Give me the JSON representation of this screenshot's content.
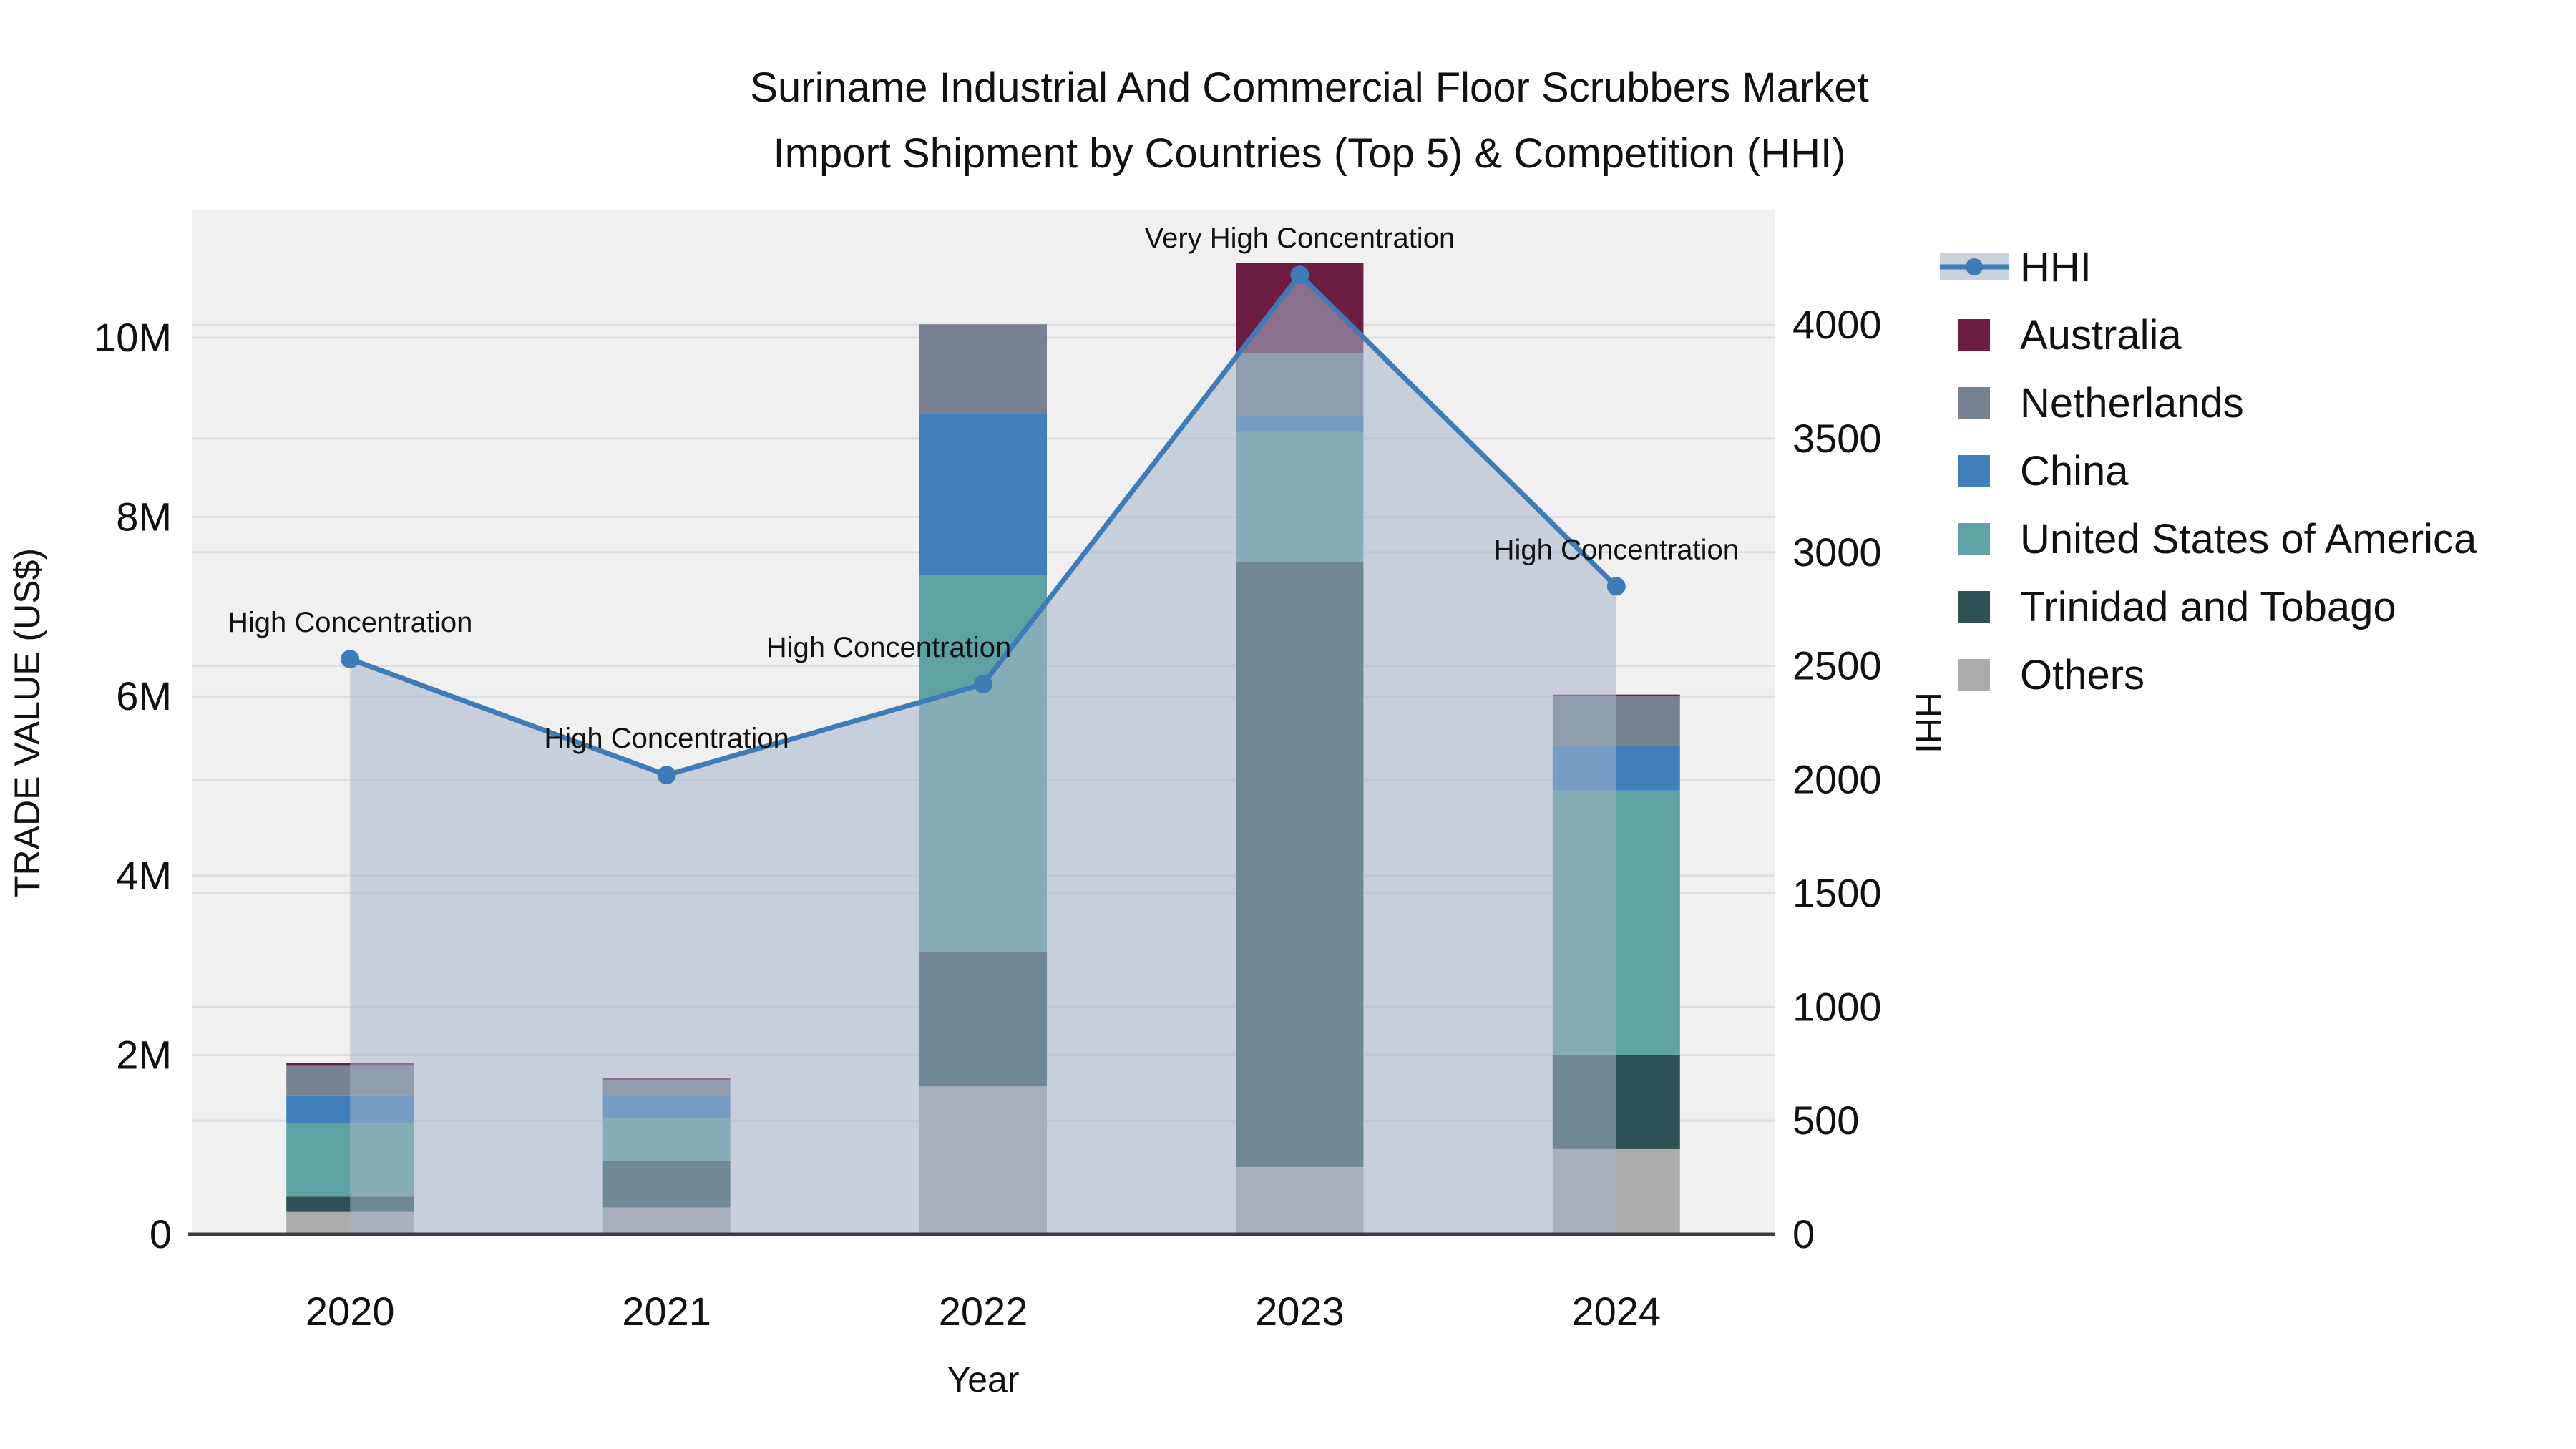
{
  "chart_data": {
    "type": "bar",
    "subtype": "stacked-bar-with-line-overlay",
    "title_line1": "Suriname Industrial And Commercial Floor Scrubbers Market",
    "title_line2": "Import Shipment by Countries (Top 5) & Competition (HHI)",
    "xlabel": "Year",
    "ylabel_left": "TRADE VALUE (US$)",
    "ylabel_right": "HHI",
    "categories": [
      "2020",
      "2021",
      "2022",
      "2023",
      "2024"
    ],
    "left_axis": {
      "tick_labels": [
        "0",
        "2M",
        "4M",
        "6M",
        "8M",
        "10M"
      ],
      "tick_values_millions": [
        0,
        2,
        4,
        6,
        8,
        10
      ],
      "range_millions": [
        0,
        11.4
      ],
      "grid": true
    },
    "right_axis": {
      "tick_labels": [
        "0",
        "500",
        "1000",
        "1500",
        "2000",
        "2500",
        "3000",
        "3500",
        "4000"
      ],
      "tick_values": [
        0,
        500,
        1000,
        1500,
        2000,
        2500,
        3000,
        3500,
        4000
      ],
      "range": [
        0,
        4500
      ],
      "grid": true
    },
    "stack_order_bottom_to_top": [
      "Others",
      "Trinidad and Tobago",
      "United States of America",
      "China",
      "Netherlands",
      "Australia"
    ],
    "series": [
      {
        "name": "Australia",
        "color": "#6C1D41",
        "values_millions": [
          0.03,
          0.02,
          0.0,
          1.0,
          0.02
        ]
      },
      {
        "name": "Netherlands",
        "color": "#76828F",
        "values_millions": [
          0.33,
          0.18,
          1.0,
          0.7,
          0.55
        ]
      },
      {
        "name": "China",
        "color": "#3F7FBC",
        "values_millions": [
          0.31,
          0.25,
          1.8,
          0.18,
          0.5
        ]
      },
      {
        "name": "United States of America",
        "color": "#5FA2A3",
        "values_millions": [
          0.82,
          0.47,
          4.2,
          1.45,
          2.95
        ]
      },
      {
        "name": "Trinidad and Tobago",
        "color": "#2F5054",
        "values_millions": [
          0.17,
          0.52,
          1.5,
          6.75,
          1.05
        ]
      },
      {
        "name": "Others",
        "color": "#ACACAC",
        "values_millions": [
          0.25,
          0.3,
          1.65,
          0.75,
          0.95
        ]
      }
    ],
    "hhi": {
      "name": "HHI",
      "color": "#3E7CB8",
      "marker_color": "#3E7CB8",
      "area_fill": "rgba(165,180,200,0.55)",
      "legend_band_color": "#C9D3DD",
      "values": [
        2530,
        2020,
        2420,
        4220,
        2850
      ]
    },
    "annotations": [
      {
        "year": "2020",
        "text": "High Concentration",
        "dx": 0
      },
      {
        "year": "2021",
        "text": "High Concentration",
        "dx": 0
      },
      {
        "year": "2022",
        "text": "High Concentration",
        "dx": -132
      },
      {
        "year": "2023",
        "text": "Very High Concentration",
        "dx": 0
      },
      {
        "year": "2024",
        "text": "High Concentration",
        "dx": 0
      }
    ],
    "legend_position": "right",
    "plot_bg": "#F0F0F1",
    "grid_color": "rgba(105,115,130,0.14)",
    "axis_line_color": "#3A3E44"
  }
}
